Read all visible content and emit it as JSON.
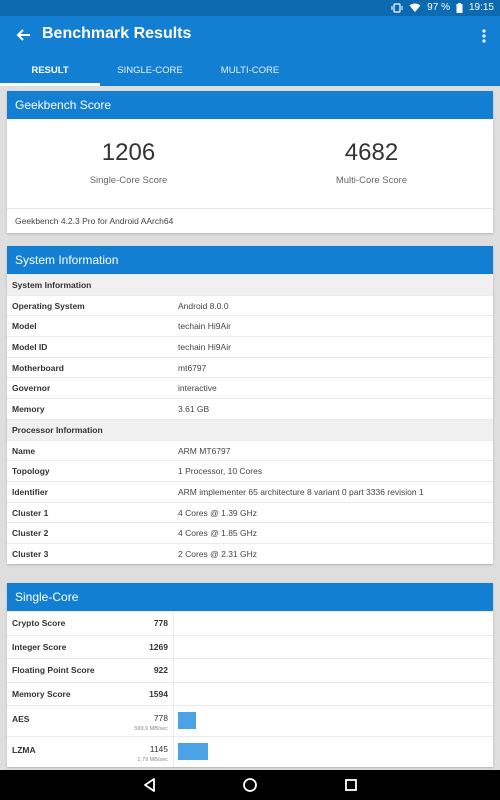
{
  "status": {
    "battery": "97 %",
    "time": "19:15"
  },
  "appbar": {
    "title": "Benchmark Results"
  },
  "tabs": [
    {
      "label": "RESULT"
    },
    {
      "label": "SINGLE-CORE"
    },
    {
      "label": "MULTI-CORE"
    }
  ],
  "geekbench": {
    "header": "Geekbench Score",
    "single_value": "1206",
    "single_label": "Single-Core Score",
    "multi_value": "4682",
    "multi_label": "Multi-Core Score",
    "version": "Geekbench 4.2.3 Pro for Android AArch64"
  },
  "sysinfo": {
    "header": "System Information",
    "section1": "System Information",
    "rows1": [
      {
        "k": "Operating System",
        "v": "Android 8.0.0"
      },
      {
        "k": "Model",
        "v": "techain Hi9Air"
      },
      {
        "k": "Model ID",
        "v": "techain Hi9Air"
      },
      {
        "k": "Motherboard",
        "v": "mt6797"
      },
      {
        "k": "Governor",
        "v": "interactive"
      },
      {
        "k": "Memory",
        "v": "3.61 GB"
      }
    ],
    "section2": "Processor Information",
    "rows2": [
      {
        "k": "Name",
        "v": "ARM MT6797"
      },
      {
        "k": "Topology",
        "v": "1 Processor, 10 Cores"
      },
      {
        "k": "Identifier",
        "v": "ARM implementer 65 architecture 8 variant 0 part 3336 revision 1"
      },
      {
        "k": "Cluster 1",
        "v": "4 Cores @ 1.39 GHz"
      },
      {
        "k": "Cluster 2",
        "v": "4 Cores @ 1.85 GHz"
      },
      {
        "k": "Cluster 3",
        "v": "2 Cores @ 2.31 GHz"
      }
    ]
  },
  "singlecore": {
    "header": "Single-Core",
    "scores": [
      {
        "k": "Crypto Score",
        "v": "778"
      },
      {
        "k": "Integer Score",
        "v": "1269"
      },
      {
        "k": "Floating Point Score",
        "v": "922"
      },
      {
        "k": "Memory Score",
        "v": "1594"
      }
    ],
    "benchmarks": [
      {
        "k": "AES",
        "v": "778",
        "rate": "599.9 MB/sec",
        "bar_fraction": 0.06
      },
      {
        "k": "LZMA",
        "v": "1145",
        "rate": "1.79 MB/sec",
        "bar_fraction": 0.1
      }
    ]
  },
  "colors": {
    "primary": "#137fd2",
    "statusbar": "#0d6ab0",
    "bar": "#4ba3e6"
  }
}
